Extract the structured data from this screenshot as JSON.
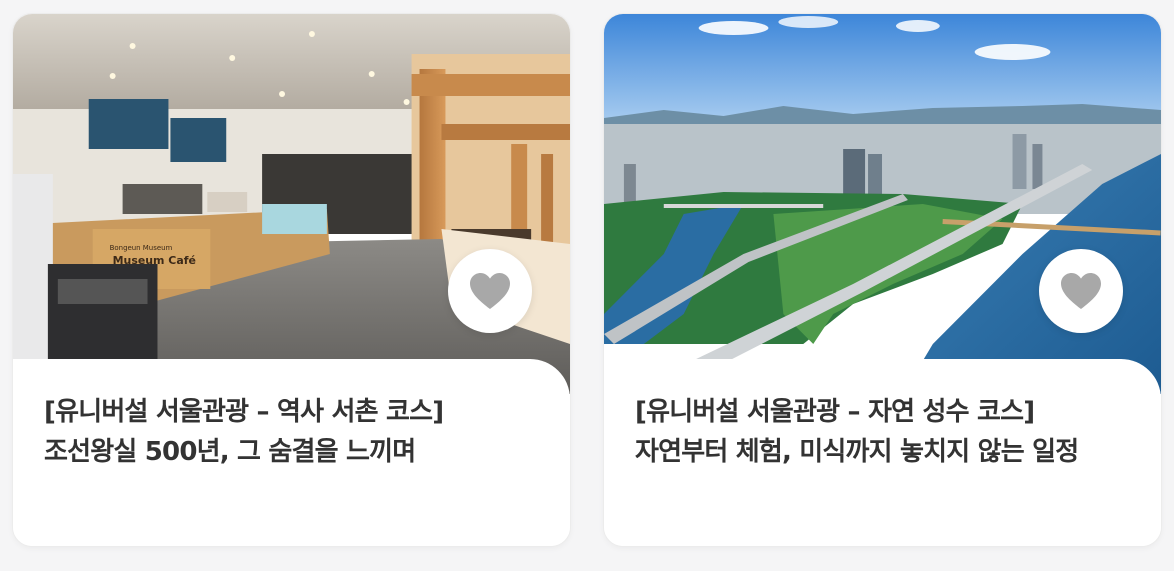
{
  "cards": [
    {
      "title_line1": "[유니버설 서울관광 – 역사 서촌 코스]",
      "title_line2": "조선왕실 500년, 그 숨결을 느끼며",
      "image": "museum-cafe-interior-photo",
      "heart_icon": "heart-icon",
      "heart_color": "#a8a8a8"
    },
    {
      "title_line1": "[유니버설 서울관광 – 자연 성수 코스]",
      "title_line2": "자연부터 체험, 미식까지 놓치지 않는 일정",
      "image": "han-river-aerial-photo",
      "heart_icon": "heart-icon",
      "heart_color": "#a8a8a8"
    }
  ],
  "colors": {
    "title": "#333333",
    "card_bg": "#ffffff",
    "page_bg": "#f5f5f6"
  }
}
